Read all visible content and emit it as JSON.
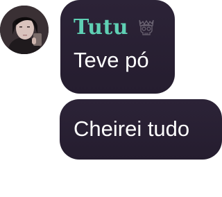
{
  "messages": [
    {
      "sender": "Tutu",
      "badge_icon": "skull-icon",
      "text": "Teve pó"
    },
    {
      "text": "Cheirei tudo"
    }
  ],
  "colors": {
    "bubble_bg": "#2a2134",
    "sender_name": "#5fd0b4",
    "message_text": "#ffffff",
    "page_bg": "#ffffff"
  }
}
